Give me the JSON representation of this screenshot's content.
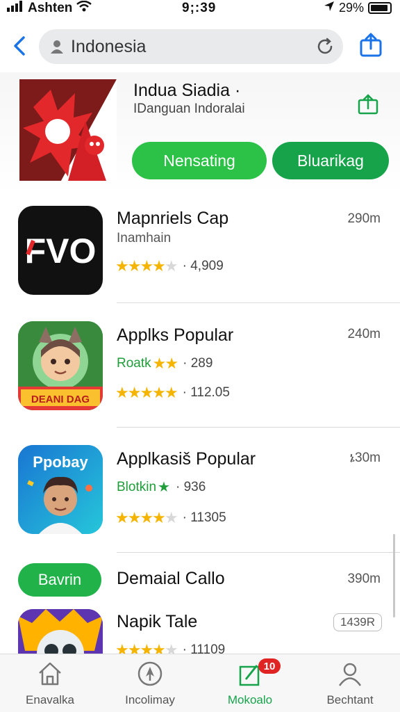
{
  "status_bar": {
    "carrier": "Ashten",
    "time": "9;:39",
    "battery": "29%"
  },
  "search": {
    "value": "Indonesia"
  },
  "featured": {
    "title": "Indua Siadia  ·",
    "subtitle": "IDanguan Indoralai",
    "primary_button": "Nensating",
    "secondary_button": "Bluarikag"
  },
  "apps": [
    {
      "title": "Mapnriels Cap",
      "subtitle": "Inamhain",
      "size": "290m",
      "rating_count": "4,909",
      "icon_text": "FVO"
    },
    {
      "title": "Applks Popular",
      "subtitle": "Roatk",
      "subtitle_extra": "289",
      "size": "240m",
      "rating_count": "112.05",
      "icon_text": "DEANI DAG"
    },
    {
      "title": "Applkasiš Popular",
      "subtitle": "Blotkin",
      "subtitle_extra": "936",
      "size": "ኔ30m",
      "rating_count": "11305",
      "icon_text": "Ppobay"
    }
  ],
  "partial_row": {
    "badge": "Bavrin",
    "title": "Demaial Callo",
    "size": "390m"
  },
  "last_app": {
    "title": "Napik Tale",
    "size_badge": "1439R",
    "rating_count": "11109"
  },
  "tabs": [
    {
      "label": "Enavalka",
      "icon": "home-icon"
    },
    {
      "label": "Incolimay",
      "icon": "compass-icon"
    },
    {
      "label": "Mokoalo",
      "icon": "update-icon",
      "badge": "10"
    },
    {
      "label": "Bechtant",
      "icon": "person-icon"
    }
  ],
  "colors": {
    "accent_green": "#2cc248",
    "dark_green": "#16a34a",
    "link_blue": "#1a73e8",
    "star": "#f4b400",
    "badge_red": "#e02424"
  }
}
